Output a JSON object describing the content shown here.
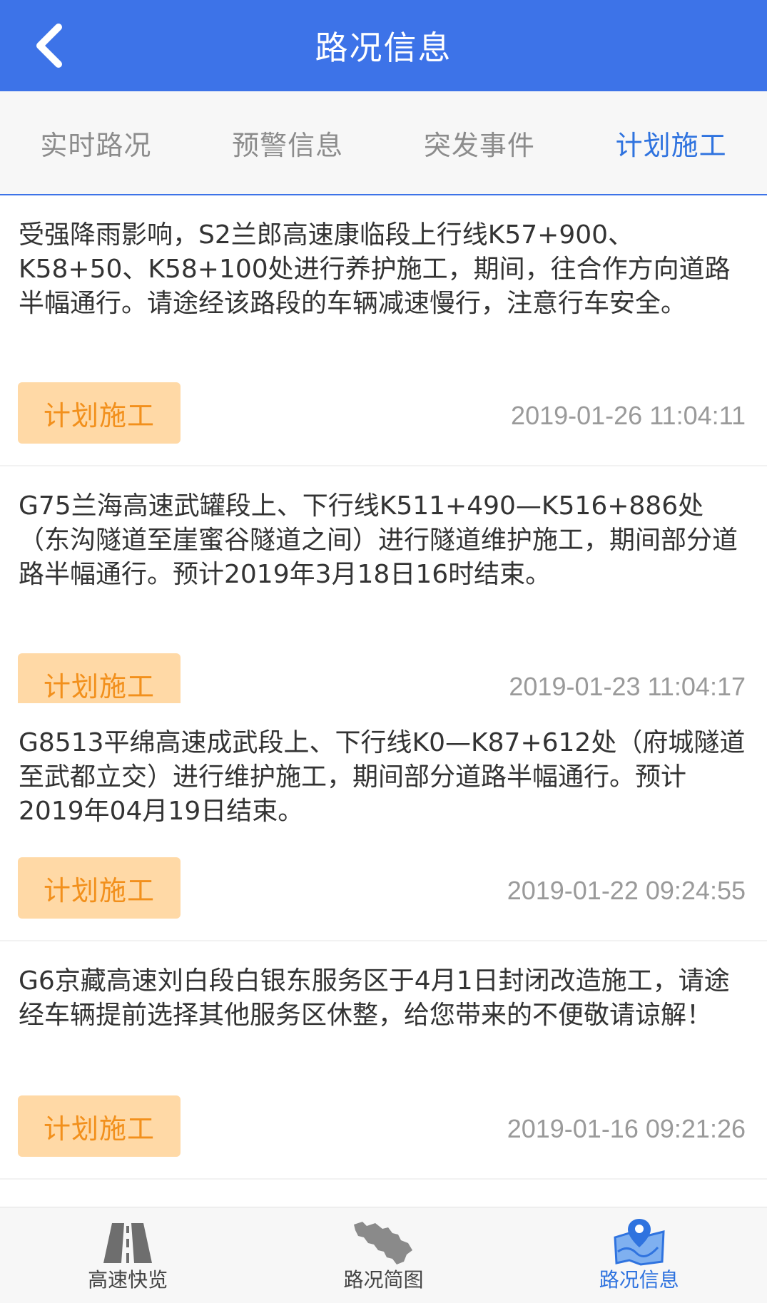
{
  "header": {
    "title": "路况信息"
  },
  "tabs": [
    {
      "label": "实时路况"
    },
    {
      "label": "预警信息"
    },
    {
      "label": "突发事件"
    },
    {
      "label": "计划施工"
    }
  ],
  "active_tab": "计划施工",
  "items": [
    {
      "text": "受强降雨影响，S2兰郎高速康临段上行线K57+900、K58+50、K58+100处进行养护施工，期间，往合作方向道路半幅通行。请途经该路段的车辆减速慢行，注意行车安全。",
      "tag": "计划施工",
      "time": "2019-01-26 11:04:11"
    },
    {
      "text": "G75兰海高速武罐段上、下行线K511+490—K516+886处（东沟隧道至崖蜜谷隧道之间）进行隧道维护施工，期间部分道路半幅通行。预计2019年3月18日16时结束。",
      "tag": "计划施工",
      "time": "2019-01-23 11:04:17"
    },
    {
      "text": "G8513平绵高速成武段上、下行线K0—K87+612处（府城隧道至武都立交）进行维护施工，期间部分道路半幅通行。预计2019年04月19日结束。",
      "tag": "计划施工",
      "time": "2019-01-22 09:24:55"
    },
    {
      "text": "G6京藏高速刘白段白银东服务区于4月1日封闭改造施工，请途经车辆提前选择其他服务区休整，给您带来的不便敬请谅解！",
      "tag": "计划施工",
      "time": "2019-01-16 09:21:26"
    }
  ],
  "bottom_nav": [
    {
      "label": "高速快览",
      "icon": "highway-icon"
    },
    {
      "label": "路况简图",
      "icon": "map-outline-icon"
    },
    {
      "label": "路况信息",
      "icon": "map-pin-icon"
    }
  ],
  "colors": {
    "primary": "#3d73e8",
    "tag_bg": "#ffd9a6",
    "tag_text": "#f2901c"
  }
}
